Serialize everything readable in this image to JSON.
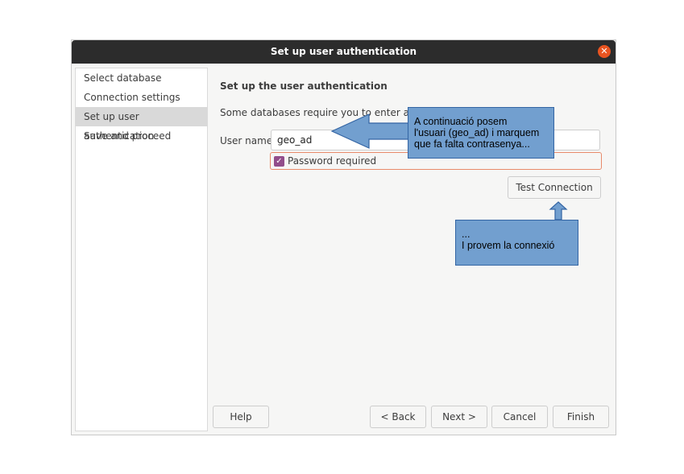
{
  "window": {
    "title": "Set up user authentication"
  },
  "sidebar": {
    "items": [
      {
        "label": "Select database",
        "active": false
      },
      {
        "label": "Connection settings",
        "active": false
      },
      {
        "label": "Set up user authentication",
        "active": true
      },
      {
        "label": "Save and proceed",
        "active": false
      }
    ]
  },
  "main": {
    "heading": "Set up the user authentication",
    "description": "Some databases require you to enter a user",
    "user_label": "User name",
    "user_value": "geo_ad",
    "password_required_label": "Password required",
    "password_required_checked": true,
    "test_connection_label": "Test Connection"
  },
  "footer": {
    "help_label": "Help",
    "back_label": "< Back",
    "next_label": "Next >",
    "cancel_label": "Cancel",
    "finish_label": "Finish"
  },
  "annotations": {
    "note1": "A continuació posem\nl'usuari (geo_ad) i marquem\nque fa falta contrasenya...",
    "note2": "...\nI provem la connexió"
  },
  "colors": {
    "accent": "#e95420",
    "checkbox": "#924d8b",
    "annotation_fill": "#729fcf",
    "annotation_border": "#3465a4"
  }
}
